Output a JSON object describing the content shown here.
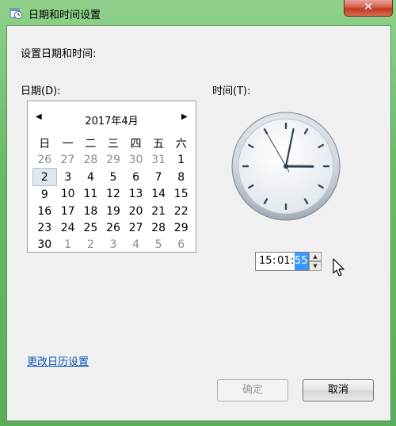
{
  "window": {
    "title": "日期和时间设置",
    "close_symbol": "✕"
  },
  "section_title": "设置日期和时间:",
  "date_label": "日期(D):",
  "time_label": "时间(T):",
  "calendar": {
    "month": "2017年4月",
    "prev_symbol": "◀",
    "next_symbol": "▶",
    "weekdays": [
      "日",
      "一",
      "二",
      "三",
      "四",
      "五",
      "六"
    ],
    "weeks": [
      [
        {
          "t": "26",
          "o": true
        },
        {
          "t": "27",
          "o": true
        },
        {
          "t": "28",
          "o": true
        },
        {
          "t": "29",
          "o": true
        },
        {
          "t": "30",
          "o": true
        },
        {
          "t": "31",
          "o": true
        },
        {
          "t": "1",
          "o": false
        }
      ],
      [
        {
          "t": "2",
          "o": false,
          "today": true
        },
        {
          "t": "3",
          "o": false
        },
        {
          "t": "4",
          "o": false
        },
        {
          "t": "5",
          "o": false
        },
        {
          "t": "6",
          "o": false
        },
        {
          "t": "7",
          "o": false
        },
        {
          "t": "8",
          "o": false
        }
      ],
      [
        {
          "t": "9",
          "o": false
        },
        {
          "t": "10",
          "o": false
        },
        {
          "t": "11",
          "o": false
        },
        {
          "t": "12",
          "o": false
        },
        {
          "t": "13",
          "o": false
        },
        {
          "t": "14",
          "o": false
        },
        {
          "t": "15",
          "o": false
        }
      ],
      [
        {
          "t": "16",
          "o": false
        },
        {
          "t": "17",
          "o": false
        },
        {
          "t": "18",
          "o": false
        },
        {
          "t": "19",
          "o": false
        },
        {
          "t": "20",
          "o": false
        },
        {
          "t": "21",
          "o": false
        },
        {
          "t": "22",
          "o": false
        }
      ],
      [
        {
          "t": "23",
          "o": false
        },
        {
          "t": "24",
          "o": false
        },
        {
          "t": "25",
          "o": false
        },
        {
          "t": "26",
          "o": false
        },
        {
          "t": "27",
          "o": false
        },
        {
          "t": "28",
          "o": false
        },
        {
          "t": "29",
          "o": false
        }
      ],
      [
        {
          "t": "30",
          "o": false
        },
        {
          "t": "1",
          "o": true
        },
        {
          "t": "2",
          "o": true
        },
        {
          "t": "3",
          "o": true
        },
        {
          "t": "4",
          "o": true
        },
        {
          "t": "5",
          "o": true
        },
        {
          "t": "6",
          "o": true
        }
      ]
    ]
  },
  "clock": {
    "hour": 15,
    "minute": 1,
    "second": 55
  },
  "time_field": {
    "hours": "15",
    "sep1": ":",
    "minutes": "01",
    "sep2": ":",
    "seconds": "55"
  },
  "link_text": "更改日历设置",
  "buttons": {
    "ok": "确定",
    "cancel": "取消"
  }
}
